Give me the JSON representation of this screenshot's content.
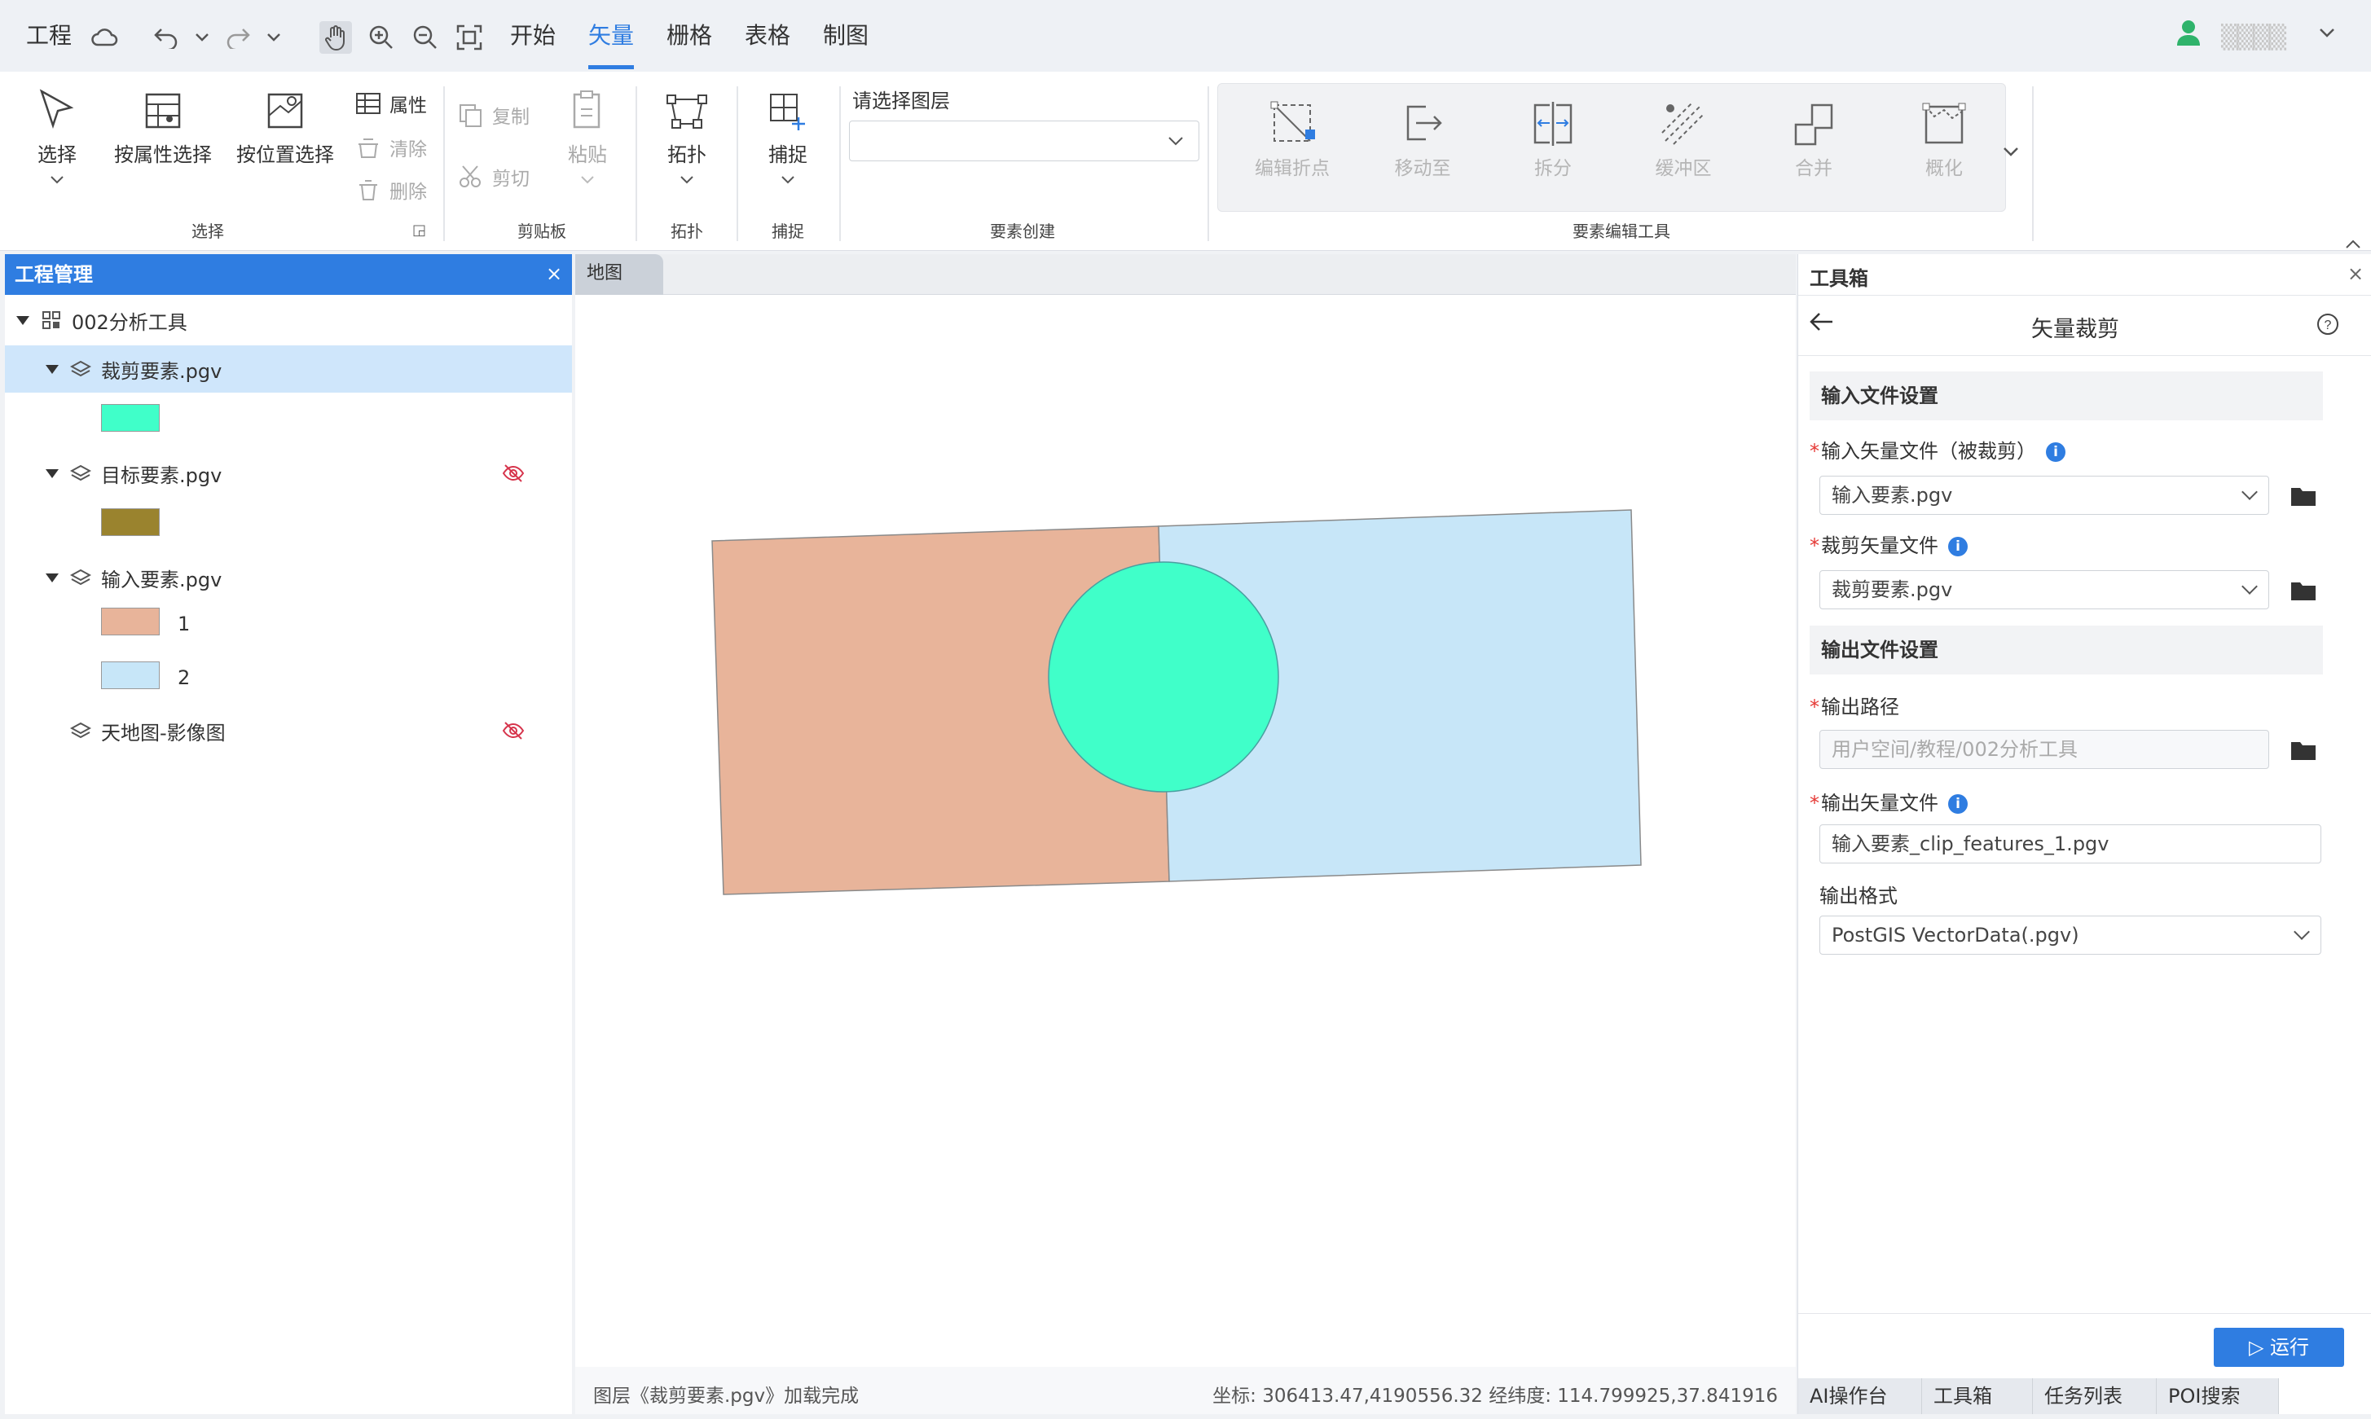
{
  "topbar": {
    "project_label": "工程",
    "tabs": [
      {
        "label": "开始"
      },
      {
        "label": "矢量",
        "active": true
      },
      {
        "label": "栅格"
      },
      {
        "label": "表格"
      },
      {
        "label": "制图"
      }
    ],
    "user_name": "▒▒▒▒"
  },
  "ribbon": {
    "select_label": "选择",
    "attr_select_label": "按属性选择",
    "loc_select_label": "按位置选择",
    "attribute_label": "属性",
    "clear_label": "清除",
    "delete_label": "删除",
    "group_select": "选择",
    "copy_label": "复制",
    "cut_label": "剪切",
    "paste_label": "粘贴",
    "group_clipboard": "剪贴板",
    "topology_label": "拓扑",
    "group_topology": "拓扑",
    "snap_label": "捕捉",
    "group_snap": "捕捉",
    "layer_select_title": "请选择图层",
    "group_create": "要素创建",
    "edit_tools": [
      "编辑折点",
      "移动至",
      "拆分",
      "缓冲区",
      "合并",
      "概化"
    ],
    "group_edit": "要素编辑工具"
  },
  "project_panel": {
    "title": "工程管理",
    "close": "×",
    "root": "002分析工具",
    "layers": [
      {
        "name": "裁剪要素.pgv",
        "swatch": "#40ffc9",
        "hidden": false
      },
      {
        "name": "目标要素.pgv",
        "swatch": "#9a832e",
        "hidden": true
      },
      {
        "name": "输入要素.pgv",
        "classes": [
          {
            "label": "1",
            "color": "#e8b49a"
          },
          {
            "label": "2",
            "color": "#c7e6f8"
          }
        ],
        "hidden": false
      },
      {
        "name": "天地图-影像图",
        "hidden": true
      }
    ]
  },
  "map": {
    "tab_label": "地图",
    "status_text": "图层《裁剪要素.pgv》加载完成",
    "coords_text": "坐标: 306413.47,4190556.32 经纬度: 114.799925,37.841916",
    "colors": {
      "left_poly": "#e8b49a",
      "right_poly": "#c7e6f8",
      "circle": "#40ffc9"
    }
  },
  "toolbox": {
    "title": "工具箱",
    "close": "×",
    "tool_title": "矢量裁剪",
    "input_section": "输入文件设置",
    "input_vector_label": "输入矢量文件（被裁剪）",
    "input_vector_value": "输入要素.pgv",
    "clip_vector_label": "裁剪矢量文件",
    "clip_vector_value": "裁剪要素.pgv",
    "output_section": "输出文件设置",
    "output_path_label": "输出路径",
    "output_path_placeholder": "用户空间/教程/002分析工具",
    "output_vector_label": "输出矢量文件",
    "output_vector_value": "输入要素_clip_features_1.pgv",
    "output_format_label": "输出格式",
    "output_format_value": "PostGIS VectorData(.pgv)",
    "run_label": "▷ 运行",
    "bottom_tabs": [
      "AI操作台",
      "工具箱",
      "任务列表",
      "POI搜索"
    ]
  }
}
